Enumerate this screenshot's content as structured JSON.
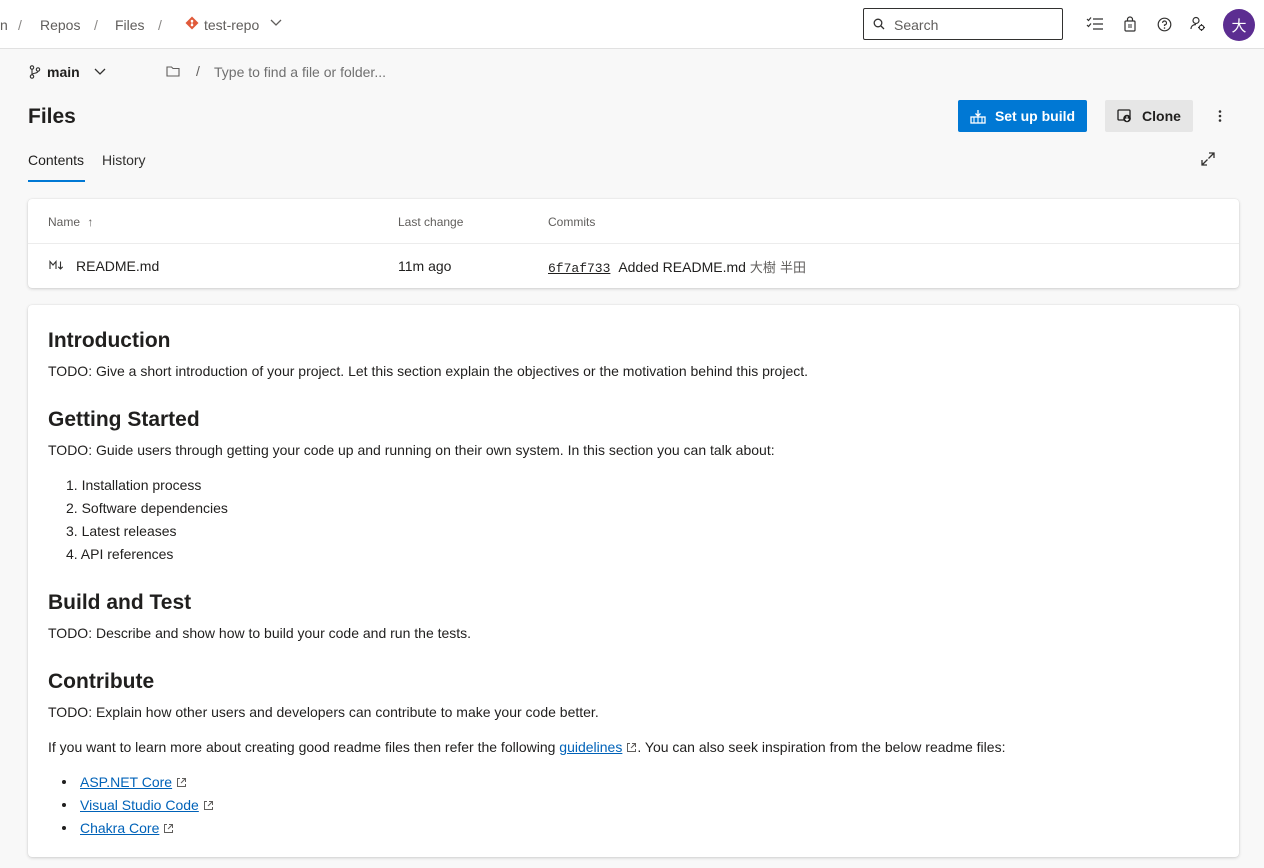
{
  "breadcrumb": {
    "partial_text": "n",
    "items": [
      "Repos",
      "Files"
    ],
    "repo_name": "test-repo"
  },
  "search": {
    "placeholder": "Search"
  },
  "header_icons": [
    "task-list-icon",
    "shopping-bag-icon",
    "help-icon",
    "user-settings-icon"
  ],
  "avatar": {
    "initial": "大",
    "color": "#5c2d91"
  },
  "branch": {
    "name": "main"
  },
  "path": {
    "placeholder": "Type to find a file or folder..."
  },
  "page": {
    "title": "Files"
  },
  "actions": {
    "setup_build": "Set up build",
    "clone": "Clone"
  },
  "tabs": [
    {
      "label": "Contents",
      "active": true
    },
    {
      "label": "History",
      "active": false
    }
  ],
  "table": {
    "columns": [
      "Name",
      "Last change",
      "Commits"
    ],
    "sort_indicator": "↑",
    "rows": [
      {
        "name": "README.md",
        "last_change": "11m ago",
        "commit_hash": "6f7af733",
        "commit_message": "Added README.md",
        "author": "大樹 半田"
      }
    ]
  },
  "readme": {
    "intro_heading": "Introduction",
    "intro_text": "TODO: Give a short introduction of your project. Let this section explain the objectives or the motivation behind this project.",
    "getting_started_heading": "Getting Started",
    "getting_started_text": "TODO: Guide users through getting your code up and running on their own system. In this section you can talk about:",
    "getting_started_list": [
      "Installation process",
      "Software dependencies",
      "Latest releases",
      "API references"
    ],
    "build_heading": "Build and Test",
    "build_text": "TODO: Describe and show how to build your code and run the tests.",
    "contribute_heading": "Contribute",
    "contribute_text": "TODO: Explain how other users and developers can contribute to make your code better.",
    "learn_more_prefix": "If you want to learn more about creating good readme files then refer the following",
    "learn_more_link": "guidelines",
    "learn_more_suffix": ". You can also seek inspiration from the below readme files:",
    "example_links": [
      "ASP.NET Core",
      "Visual Studio Code",
      "Chakra Core"
    ]
  },
  "colors": {
    "primary": "#0078d4",
    "link": "#0062b8",
    "repo_icon": "#e05a3a"
  }
}
